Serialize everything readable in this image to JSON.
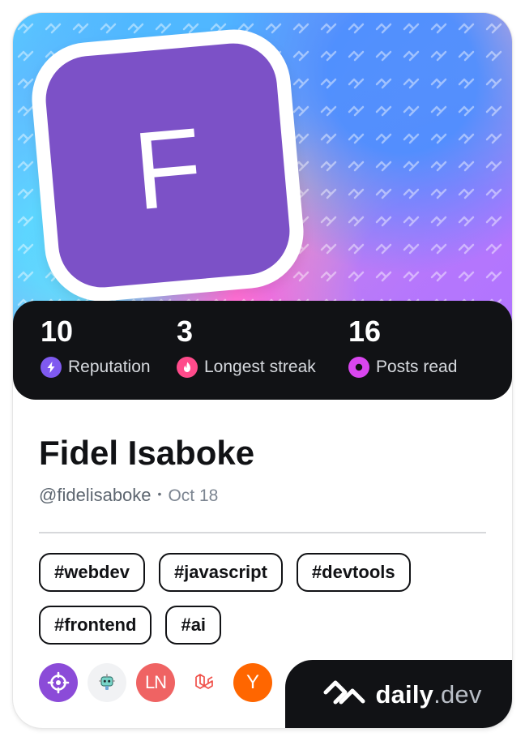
{
  "colors": {
    "card_background": "#ffffff",
    "stats_background": "#111215",
    "avatar_background": "#7c51c7",
    "reputation_icon": "#7f5af0",
    "streak_icon": "#ff4b8b",
    "posts_icon": "#d946ef"
  },
  "avatar": {
    "letter": "F"
  },
  "stats": [
    {
      "value": "10",
      "label": "Reputation",
      "icon": "lightning-icon"
    },
    {
      "value": "3",
      "label": "Longest streak",
      "icon": "flame-icon"
    },
    {
      "value": "16",
      "label": "Posts read",
      "icon": "eye-icon"
    }
  ],
  "profile": {
    "name": "Fidel Isaboke",
    "handle": "@fidelisaboke",
    "separator": "•",
    "date": "Oct 18"
  },
  "tags": [
    "#webdev",
    "#javascript",
    "#devtools",
    "#frontend",
    "#ai"
  ],
  "sources": [
    {
      "icon": "crosshair-icon",
      "text": ""
    },
    {
      "icon": "robot-icon",
      "text": ""
    },
    {
      "icon": "ln-icon",
      "text": "LN"
    },
    {
      "icon": "laravel-icon",
      "text": ""
    },
    {
      "icon": "y-combinator-icon",
      "text": "Y"
    }
  ],
  "brand": {
    "name": "daily",
    "suffix": ".dev"
  }
}
